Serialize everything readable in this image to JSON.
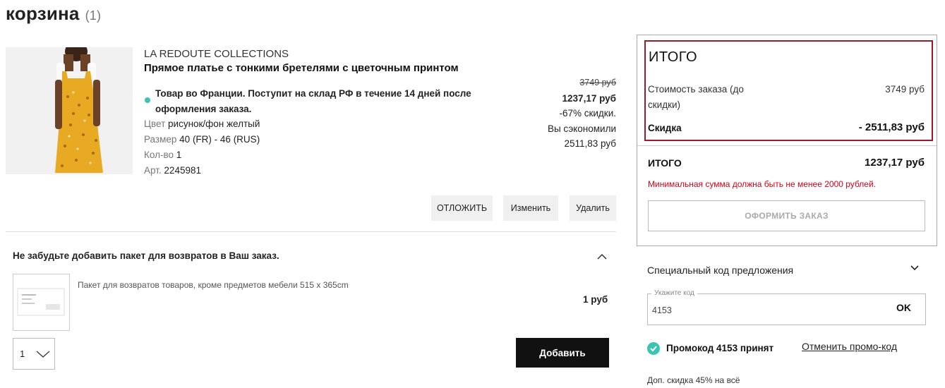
{
  "cart": {
    "title": "корзина",
    "count": "(1)"
  },
  "product": {
    "brand": "LA REDOUTE COLLECTIONS",
    "name": "Прямое платье с тонкими бретелями с цветочным принтом",
    "availability": "Товар во Франции. Поступит на склад РФ в течение 14 дней после оформления заказа.",
    "color_label": "Цвет",
    "color_value": "рисунок/фон желтый",
    "size_label": "Размер",
    "size_value": "40 (FR) - 46 (RUS)",
    "qty_label": "Кол-во",
    "qty_value": "1",
    "sku_label": "Арт.",
    "sku_value": "2245981",
    "old_price": "3749 руб",
    "new_price": "1237,17 руб",
    "discount": "-67% скидки.",
    "saved_label": "Вы сэкономили",
    "saved_value": "2511,83 руб",
    "actions": {
      "postpone": "ОТЛОЖИТЬ",
      "edit": "Изменить",
      "delete": "Удалить"
    }
  },
  "return_bag": {
    "title": "Не забудьте добавить пакет для возвратов в Ваш заказ.",
    "description": "Пакет для возвратов товаров, кроме предметов мебели 515 x 365cm",
    "price": "1 руб",
    "qty": "1",
    "add_label": "Добавить"
  },
  "summary": {
    "heading": "ИТОГО",
    "cost_label": "Стоимость заказа (до скидки)",
    "cost_value": "3749 руб",
    "discount_label": "Скидка",
    "discount_value": "- 2511,83 руб",
    "total_label": "ИТОГО",
    "total_value": "1237,17 руб",
    "min_warning": "Минимальная сумма должна быть не менее 2000 рублей.",
    "order_button": "ОФОРМИТЬ ЗАКАЗ"
  },
  "promo": {
    "title": "Специальный код предложения",
    "field_label": "Укажите код",
    "field_value": "4153",
    "ok_label": "OK",
    "accepted": "Промокод 4153 принят",
    "cancel_label": "Отменить промо-код",
    "extra_discount": "Доп. скидка 45% на всё"
  },
  "colors": {
    "accent_teal": "#3cc4b3",
    "warning_red": "#d0021b",
    "highlight_border": "#9b1b2c"
  }
}
